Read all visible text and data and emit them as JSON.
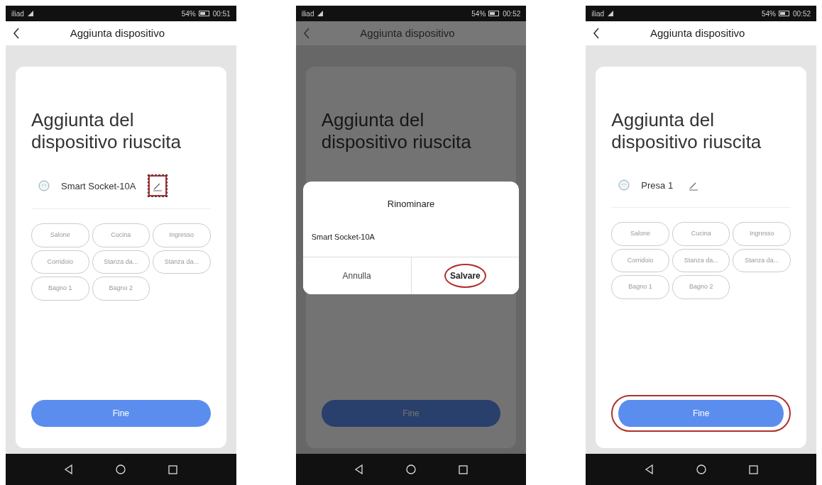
{
  "screens": [
    {
      "status_bar": {
        "carrier": "iliad",
        "battery": "54%",
        "time": "00:51"
      },
      "header": {
        "title": "Aggiunta dispositivo"
      },
      "dimmed": false,
      "card": {
        "heading": "Aggiunta del dispositivo riuscita",
        "device": {
          "name": "Smart Socket-10A",
          "edit_highlighted": true
        },
        "rooms": [
          "Salone",
          "Cucina",
          "Ingresso",
          "Corridoio",
          "Stanza da...",
          "Stanza da...",
          "Bagno 1",
          "Bagno 2"
        ],
        "done_button": {
          "label": "Fine",
          "highlighted": false
        }
      }
    },
    {
      "status_bar": {
        "carrier": "iliad",
        "battery": "54%",
        "time": "00:52"
      },
      "header": {
        "title": "Aggiunta dispositivo"
      },
      "dimmed": true,
      "card": {
        "heading": "Aggiunta del dispositivo riuscita",
        "done_button": {
          "label": "Fine",
          "highlighted": false
        }
      },
      "dialog": {
        "title": "Rinominare",
        "value": "Smart Socket-10A",
        "buttons": [
          {
            "label": "Annulla",
            "highlighted": false
          },
          {
            "label": "Salvare",
            "highlighted": true
          }
        ]
      }
    },
    {
      "status_bar": {
        "carrier": "iliad",
        "battery": "54%",
        "time": "00:52"
      },
      "header": {
        "title": "Aggiunta dispositivo"
      },
      "dimmed": false,
      "card": {
        "heading": "Aggiunta del dispositivo riuscita",
        "device": {
          "name": "Presa 1",
          "edit_highlighted": false
        },
        "rooms": [
          "Salone",
          "Cucina",
          "Ingresso",
          "Corridoio",
          "Stanza da...",
          "Stanza da...",
          "Bagno 1",
          "Bagno 2"
        ],
        "done_button": {
          "label": "Fine",
          "highlighted": true
        }
      }
    }
  ]
}
